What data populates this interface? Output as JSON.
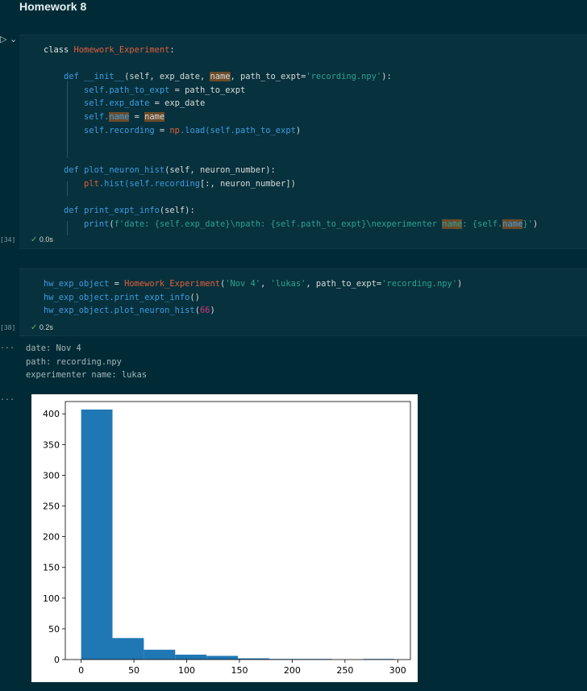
{
  "notebook": {
    "heading": "Homework 8",
    "collapse_glyph": "▷ ⌄"
  },
  "cell1": {
    "exec_count": "[34]",
    "status_time": "0.0s",
    "code": {
      "l1_kw": "class ",
      "l1_name": "Homework_Experiment",
      "l1_end": ":",
      "l2_kw": "def ",
      "l2_fn": "__init__",
      "l2_a": "(self, exp_date, ",
      "l2_name": "name",
      "l2_b": ", path_to_expt=",
      "l2_str": "'recording.npy'",
      "l2_end": "):",
      "l3_a": "self",
      "l3_b": ".path_to_expt",
      "l3_c": " = path_to_expt",
      "l4_a": "self",
      "l4_b": ".exp_date",
      "l4_c": " = exp_date",
      "l5_a": "self",
      "l5_b": ".",
      "l5_name": "name",
      "l5_c": " = ",
      "l5_val": "name",
      "l6_a": "self",
      "l6_b": ".recording",
      "l6_c": " = ",
      "l6_mod": "np",
      "l6_d": ".load(",
      "l6_e": "self.path_to_expt",
      "l6_end": ")",
      "l7_kw": "def ",
      "l7_fn": "plot_neuron_hist",
      "l7_a": "(self, neuron_number):",
      "l8_mod": "plt",
      "l8_a": ".hist(",
      "l8_b": "self.recording",
      "l8_c": "[:, neuron_number]",
      "l8_end": ")",
      "l9_kw": "def ",
      "l9_fn": "print_expt_info",
      "l9_a": "(self):",
      "l10_fn": "print",
      "l10_a": "(",
      "l10_s1": "f'date: {self.exp_date}\\npath: {self.path_to_expt}\\nexperimenter ",
      "l10_name": "name",
      "l10_s2": ": {self.",
      "l10_name2": "name",
      "l10_s3": "}'",
      "l10_end": ")"
    }
  },
  "cell2": {
    "exec_count": "[38]",
    "status_time": "0.2s",
    "code": {
      "l1_a": "hw_exp_object",
      "l1_b": " = ",
      "l1_cls": "Homework_Experiment",
      "l1_c": "(",
      "l1_s1": "'Nov 4'",
      "l1_d": ", ",
      "l1_s2": "'lukas'",
      "l1_e": ", path_to_expt=",
      "l1_s3": "'recording.npy'",
      "l1_end": ")",
      "l2_a": "hw_exp_object",
      "l2_b": ".print_expt_info",
      "l2_end": "()",
      "l3_a": "hw_exp_object",
      "l3_b": ".plot_neuron_hist",
      "l3_c": "(",
      "l3_num": "66",
      "l3_end": ")"
    }
  },
  "output": {
    "ellipsis": "...",
    "lines": [
      "date: Nov 4",
      "path: recording.npy",
      "experimenter name: lukas"
    ]
  },
  "chart_data": {
    "type": "bar",
    "title": "",
    "xlabel": "",
    "ylabel": "",
    "xlim": [
      -15,
      312
    ],
    "ylim": [
      0,
      420
    ],
    "xticks": [
      0,
      50,
      100,
      150,
      200,
      250,
      300
    ],
    "yticks": [
      0,
      50,
      100,
      150,
      200,
      250,
      300,
      350,
      400
    ],
    "bin_edges": [
      0,
      29.7,
      59.4,
      89.1,
      118.8,
      148.5,
      178.2,
      207.9,
      237.6,
      267.3,
      297
    ],
    "counts": [
      407,
      35,
      16,
      8,
      6,
      2,
      1,
      1,
      0,
      1
    ],
    "bar_color": "#1f77b4",
    "grid": false
  }
}
